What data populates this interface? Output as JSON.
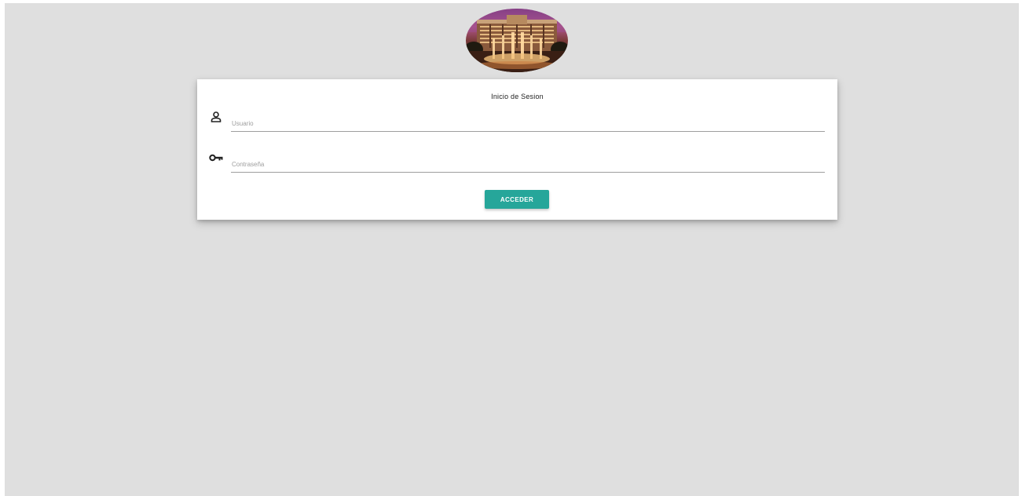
{
  "login": {
    "title": "Inicio de Sesion",
    "username": {
      "placeholder": "Usuario",
      "value": "",
      "icon": "person-outline-icon"
    },
    "password": {
      "placeholder": "Contraseña",
      "value": "",
      "icon": "key-icon"
    },
    "submit_label": "ACCEDER"
  },
  "colors": {
    "background": "#dfdfdf",
    "card": "#ffffff",
    "accent": "#26a69a"
  }
}
